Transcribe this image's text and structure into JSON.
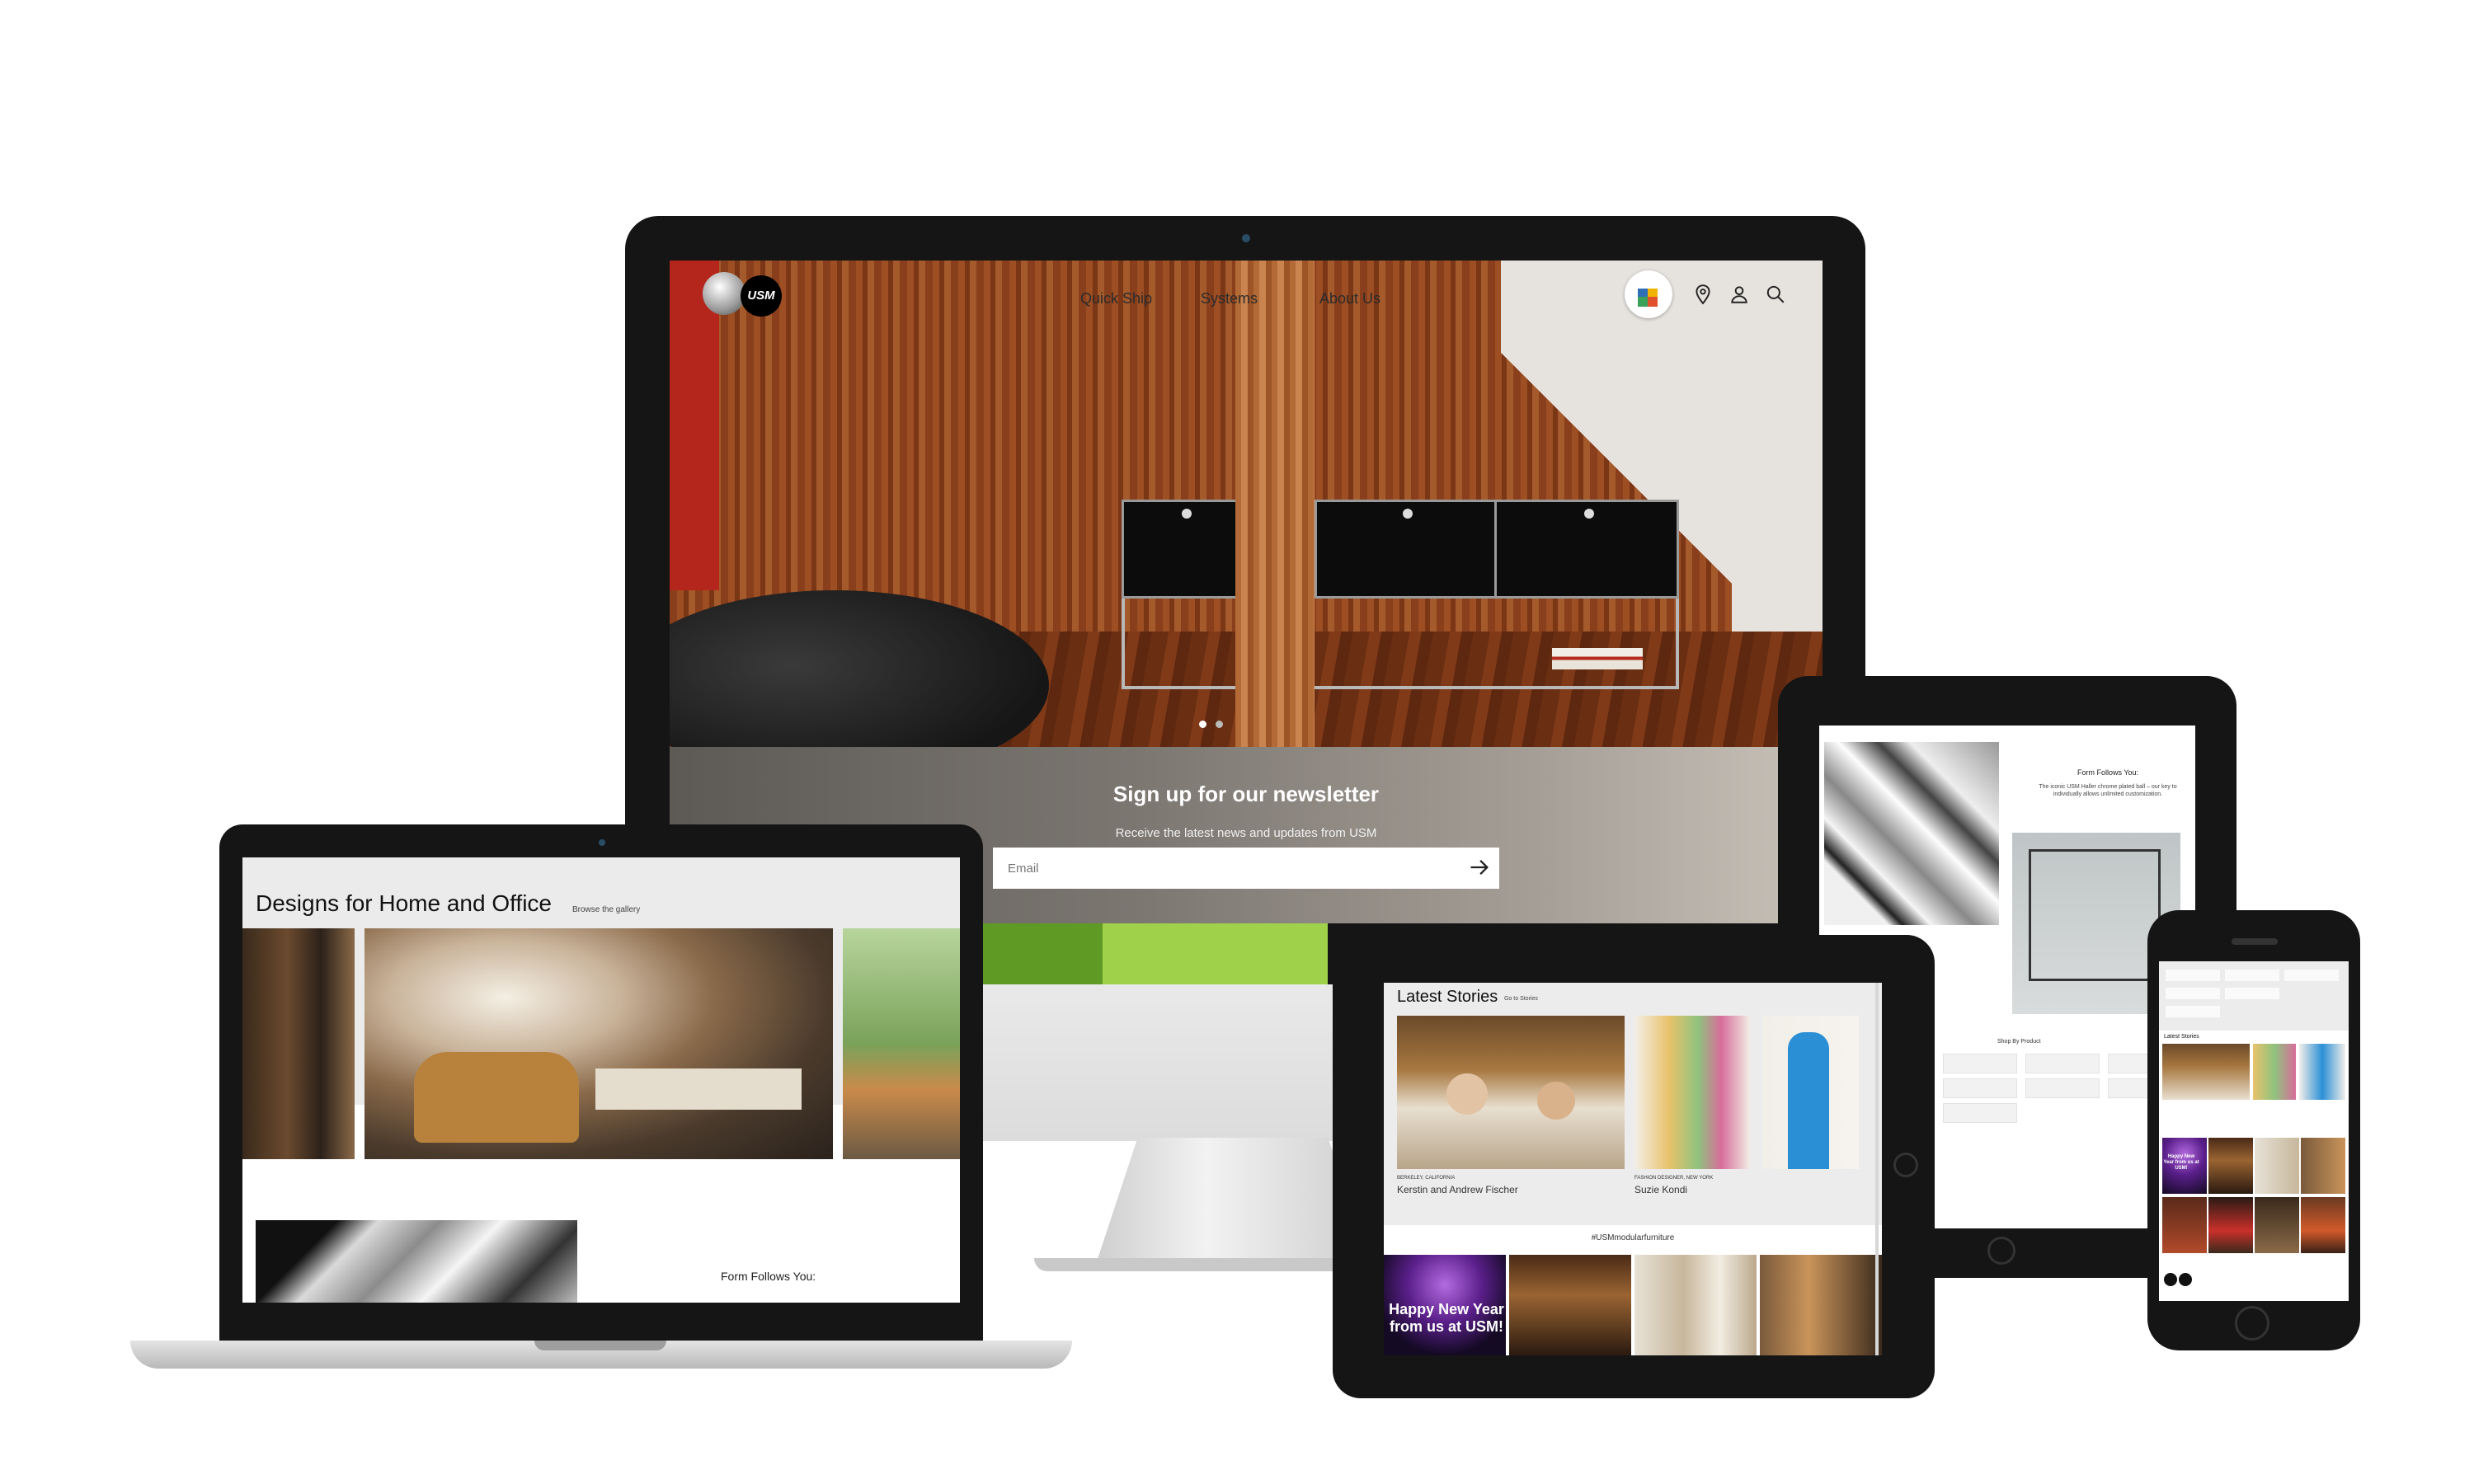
{
  "desktop": {
    "nav": {
      "logo_text": "USM",
      "links": [
        "Quick Ship",
        "Systems",
        "About Us"
      ]
    },
    "icons": [
      "configurator-icon",
      "location-pin-icon",
      "user-icon",
      "search-icon"
    ],
    "newsletter": {
      "title": "Sign up for our newsletter",
      "subtitle": "Receive the latest news and updates from USM",
      "email_placeholder": "Email"
    }
  },
  "laptop": {
    "title": "Designs for Home and Office",
    "browse_link": "Browse the gallery",
    "section_title": "Form Follows You:"
  },
  "tablet_back": {
    "form_title": "Form Follows You:",
    "form_text": "The iconic USM Haller chrome plated ball – our key to individually allows unlimited customization.",
    "shop_by_product": "Shop By Product"
  },
  "tablet_front": {
    "title": "Latest Stories",
    "goto_link": "Go to Stories",
    "stories": [
      {
        "location": "BERKELEY, CALIFORNIA",
        "name": "Kerstin and Andrew Fischer"
      },
      {
        "location": "FASHION DESIGNER, NEW YORK",
        "name": "Suzie Kondi"
      }
    ],
    "hashtag": "#USMmodularfurniture",
    "instagram_post": "Happy New Year from us at USM!"
  },
  "phone": {
    "title": "Latest Stories",
    "instagram_post": "Happy New Year from us at USM!"
  },
  "colors": {
    "device_black": "#151515",
    "brand_black": "#000000",
    "accent_red": "#b4261b",
    "accent_green": "#8cc63f"
  }
}
